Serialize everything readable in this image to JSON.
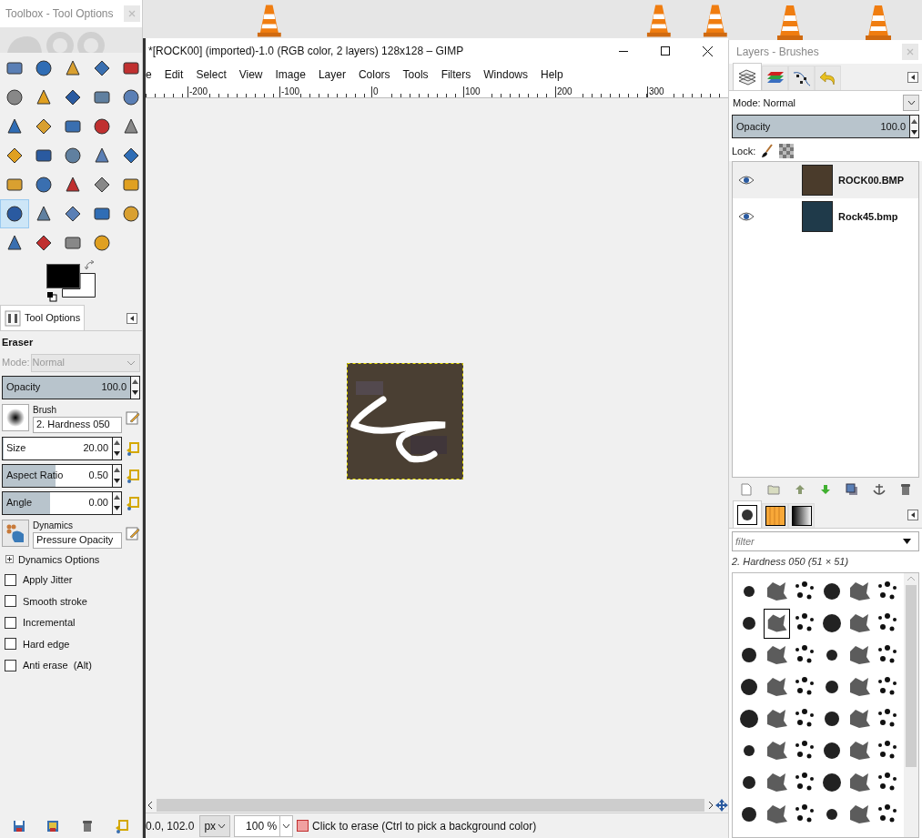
{
  "toolbox": {
    "title": "Toolbox - Tool Options",
    "tools": [
      {
        "selected": false
      },
      {
        "selected": false
      },
      {
        "selected": false
      },
      {
        "selected": false
      },
      {
        "selected": false
      },
      {
        "selected": false
      },
      {
        "selected": false
      },
      {
        "selected": false
      },
      {
        "selected": false
      },
      {
        "selected": false
      },
      {
        "selected": false
      },
      {
        "selected": false
      },
      {
        "selected": false
      },
      {
        "selected": false
      },
      {
        "selected": false
      },
      {
        "selected": false
      },
      {
        "selected": false
      },
      {
        "selected": false
      },
      {
        "selected": false
      },
      {
        "selected": false
      },
      {
        "selected": false
      },
      {
        "selected": false
      },
      {
        "selected": false
      },
      {
        "selected": false
      },
      {
        "selected": false
      },
      {
        "selected": true
      },
      {
        "selected": false
      },
      {
        "selected": false
      },
      {
        "selected": false
      },
      {
        "selected": false
      },
      {
        "selected": false
      },
      {
        "selected": false
      },
      {
        "selected": false
      },
      {
        "selected": false
      }
    ]
  },
  "tool_options": {
    "tab": "Tool Options",
    "tool_name": "Eraser",
    "mode_label": "Mode:",
    "mode_value": "Normal",
    "mode_disabled": true,
    "opacity": {
      "label": "Opacity",
      "value": "100.0",
      "level": 1
    },
    "brush": {
      "label": "Brush",
      "value": "2. Hardness 050"
    },
    "sliders": [
      {
        "label": "Size",
        "value": "20.00",
        "level": 0.01
      },
      {
        "label": "Aspect Ratio",
        "value": "0.50",
        "level": 0.48
      },
      {
        "label": "Angle",
        "value": "0.00",
        "level": 0.43
      }
    ],
    "dynamics": {
      "label": "Dynamics",
      "value": "Pressure Opacity"
    },
    "dynamics_options": {
      "label": "Dynamics Options",
      "expanded": false
    },
    "checkboxes": [
      {
        "label": "Apply Jitter",
        "checked": false
      },
      {
        "label": "Smooth stroke",
        "checked": false
      },
      {
        "label": "Incremental",
        "checked": false
      },
      {
        "label": "Hard edge",
        "checked": false
      },
      {
        "label": "Anti erase  (Alt)",
        "checked": false
      }
    ]
  },
  "image_window": {
    "title": "*[ROCK00] (imported)-1.0 (RGB color, 2 layers) 128x128 – GIMP",
    "menu": [
      "e",
      "Edit",
      "Select",
      "View",
      "Image",
      "Layer",
      "Colors",
      "Tools",
      "Filters",
      "Windows",
      "Help"
    ],
    "ruler_labels": [
      "-200",
      "-100",
      "0",
      "100",
      "200",
      "300"
    ],
    "status": {
      "coords": "0.0, 102.0",
      "unit": "px",
      "zoom": "100 %",
      "message": "Click to erase (Ctrl to pick a background color)"
    }
  },
  "layers_dock": {
    "title": "Layers - Brushes",
    "tabs": [
      {
        "selected": true
      },
      {
        "selected": false
      },
      {
        "selected": false
      },
      {
        "selected": false
      }
    ],
    "mode_label": "Mode:",
    "mode_value": "Normal",
    "opacity": {
      "label": "Opacity",
      "value": "100.0",
      "level": 1
    },
    "lock_label": "Lock:",
    "layers": [
      {
        "name": "ROCK00.BMP",
        "visible": true,
        "selected": true,
        "color": "#4a3b2b"
      },
      {
        "name": "Rock45.bmp",
        "visible": true,
        "selected": false,
        "color": "#1f3a4a"
      }
    ]
  },
  "brushes": {
    "tabs": [
      {
        "selected": true
      },
      {
        "selected": false
      },
      {
        "selected": false
      }
    ],
    "filter_placeholder": "filter",
    "selected_label": "2. Hardness 050 (51 × 51)",
    "items": [
      {
        "selected": false
      },
      {
        "selected": false
      },
      {
        "selected": false
      },
      {
        "selected": false
      },
      {
        "selected": false
      },
      {
        "selected": false
      },
      {
        "selected": false
      },
      {
        "selected": true
      },
      {
        "selected": false
      },
      {
        "selected": false
      },
      {
        "selected": false
      },
      {
        "selected": false
      },
      {
        "selected": false
      },
      {
        "selected": false
      },
      {
        "selected": false
      },
      {
        "selected": false
      },
      {
        "selected": false
      },
      {
        "selected": false
      },
      {
        "selected": false
      },
      {
        "selected": false
      },
      {
        "selected": false
      },
      {
        "selected": false
      },
      {
        "selected": false
      },
      {
        "selected": false
      },
      {
        "selected": false
      },
      {
        "selected": false
      },
      {
        "selected": false
      },
      {
        "selected": false
      },
      {
        "selected": false
      },
      {
        "selected": false
      },
      {
        "selected": false
      },
      {
        "selected": false
      },
      {
        "selected": false
      },
      {
        "selected": false
      },
      {
        "selected": false
      },
      {
        "selected": false
      },
      {
        "selected": false
      },
      {
        "selected": false
      },
      {
        "selected": false
      },
      {
        "selected": false
      },
      {
        "selected": false
      },
      {
        "selected": false
      },
      {
        "selected": false
      },
      {
        "selected": false
      },
      {
        "selected": false
      },
      {
        "selected": false
      },
      {
        "selected": false
      },
      {
        "selected": false
      }
    ]
  }
}
